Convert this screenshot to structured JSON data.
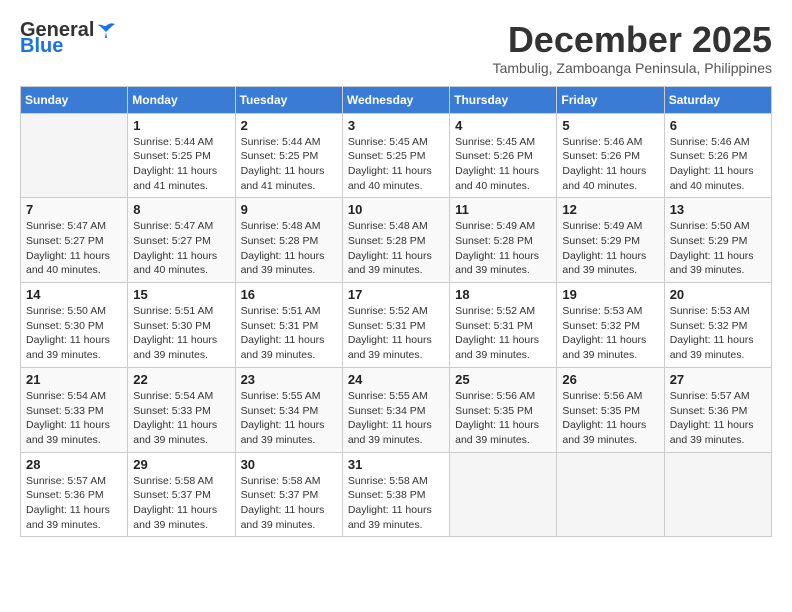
{
  "header": {
    "logo_line1": "General",
    "logo_line2": "Blue",
    "month_title": "December 2025",
    "subtitle": "Tambulig, Zamboanga Peninsula, Philippines"
  },
  "days_of_week": [
    "Sunday",
    "Monday",
    "Tuesday",
    "Wednesday",
    "Thursday",
    "Friday",
    "Saturday"
  ],
  "weeks": [
    [
      {
        "day": "",
        "info": ""
      },
      {
        "day": "1",
        "info": "Sunrise: 5:44 AM\nSunset: 5:25 PM\nDaylight: 11 hours\nand 41 minutes."
      },
      {
        "day": "2",
        "info": "Sunrise: 5:44 AM\nSunset: 5:25 PM\nDaylight: 11 hours\nand 41 minutes."
      },
      {
        "day": "3",
        "info": "Sunrise: 5:45 AM\nSunset: 5:25 PM\nDaylight: 11 hours\nand 40 minutes."
      },
      {
        "day": "4",
        "info": "Sunrise: 5:45 AM\nSunset: 5:26 PM\nDaylight: 11 hours\nand 40 minutes."
      },
      {
        "day": "5",
        "info": "Sunrise: 5:46 AM\nSunset: 5:26 PM\nDaylight: 11 hours\nand 40 minutes."
      },
      {
        "day": "6",
        "info": "Sunrise: 5:46 AM\nSunset: 5:26 PM\nDaylight: 11 hours\nand 40 minutes."
      }
    ],
    [
      {
        "day": "7",
        "info": "Sunrise: 5:47 AM\nSunset: 5:27 PM\nDaylight: 11 hours\nand 40 minutes."
      },
      {
        "day": "8",
        "info": "Sunrise: 5:47 AM\nSunset: 5:27 PM\nDaylight: 11 hours\nand 40 minutes."
      },
      {
        "day": "9",
        "info": "Sunrise: 5:48 AM\nSunset: 5:28 PM\nDaylight: 11 hours\nand 39 minutes."
      },
      {
        "day": "10",
        "info": "Sunrise: 5:48 AM\nSunset: 5:28 PM\nDaylight: 11 hours\nand 39 minutes."
      },
      {
        "day": "11",
        "info": "Sunrise: 5:49 AM\nSunset: 5:28 PM\nDaylight: 11 hours\nand 39 minutes."
      },
      {
        "day": "12",
        "info": "Sunrise: 5:49 AM\nSunset: 5:29 PM\nDaylight: 11 hours\nand 39 minutes."
      },
      {
        "day": "13",
        "info": "Sunrise: 5:50 AM\nSunset: 5:29 PM\nDaylight: 11 hours\nand 39 minutes."
      }
    ],
    [
      {
        "day": "14",
        "info": "Sunrise: 5:50 AM\nSunset: 5:30 PM\nDaylight: 11 hours\nand 39 minutes."
      },
      {
        "day": "15",
        "info": "Sunrise: 5:51 AM\nSunset: 5:30 PM\nDaylight: 11 hours\nand 39 minutes."
      },
      {
        "day": "16",
        "info": "Sunrise: 5:51 AM\nSunset: 5:31 PM\nDaylight: 11 hours\nand 39 minutes."
      },
      {
        "day": "17",
        "info": "Sunrise: 5:52 AM\nSunset: 5:31 PM\nDaylight: 11 hours\nand 39 minutes."
      },
      {
        "day": "18",
        "info": "Sunrise: 5:52 AM\nSunset: 5:31 PM\nDaylight: 11 hours\nand 39 minutes."
      },
      {
        "day": "19",
        "info": "Sunrise: 5:53 AM\nSunset: 5:32 PM\nDaylight: 11 hours\nand 39 minutes."
      },
      {
        "day": "20",
        "info": "Sunrise: 5:53 AM\nSunset: 5:32 PM\nDaylight: 11 hours\nand 39 minutes."
      }
    ],
    [
      {
        "day": "21",
        "info": "Sunrise: 5:54 AM\nSunset: 5:33 PM\nDaylight: 11 hours\nand 39 minutes."
      },
      {
        "day": "22",
        "info": "Sunrise: 5:54 AM\nSunset: 5:33 PM\nDaylight: 11 hours\nand 39 minutes."
      },
      {
        "day": "23",
        "info": "Sunrise: 5:55 AM\nSunset: 5:34 PM\nDaylight: 11 hours\nand 39 minutes."
      },
      {
        "day": "24",
        "info": "Sunrise: 5:55 AM\nSunset: 5:34 PM\nDaylight: 11 hours\nand 39 minutes."
      },
      {
        "day": "25",
        "info": "Sunrise: 5:56 AM\nSunset: 5:35 PM\nDaylight: 11 hours\nand 39 minutes."
      },
      {
        "day": "26",
        "info": "Sunrise: 5:56 AM\nSunset: 5:35 PM\nDaylight: 11 hours\nand 39 minutes."
      },
      {
        "day": "27",
        "info": "Sunrise: 5:57 AM\nSunset: 5:36 PM\nDaylight: 11 hours\nand 39 minutes."
      }
    ],
    [
      {
        "day": "28",
        "info": "Sunrise: 5:57 AM\nSunset: 5:36 PM\nDaylight: 11 hours\nand 39 minutes."
      },
      {
        "day": "29",
        "info": "Sunrise: 5:58 AM\nSunset: 5:37 PM\nDaylight: 11 hours\nand 39 minutes."
      },
      {
        "day": "30",
        "info": "Sunrise: 5:58 AM\nSunset: 5:37 PM\nDaylight: 11 hours\nand 39 minutes."
      },
      {
        "day": "31",
        "info": "Sunrise: 5:58 AM\nSunset: 5:38 PM\nDaylight: 11 hours\nand 39 minutes."
      },
      {
        "day": "",
        "info": ""
      },
      {
        "day": "",
        "info": ""
      },
      {
        "day": "",
        "info": ""
      }
    ]
  ]
}
